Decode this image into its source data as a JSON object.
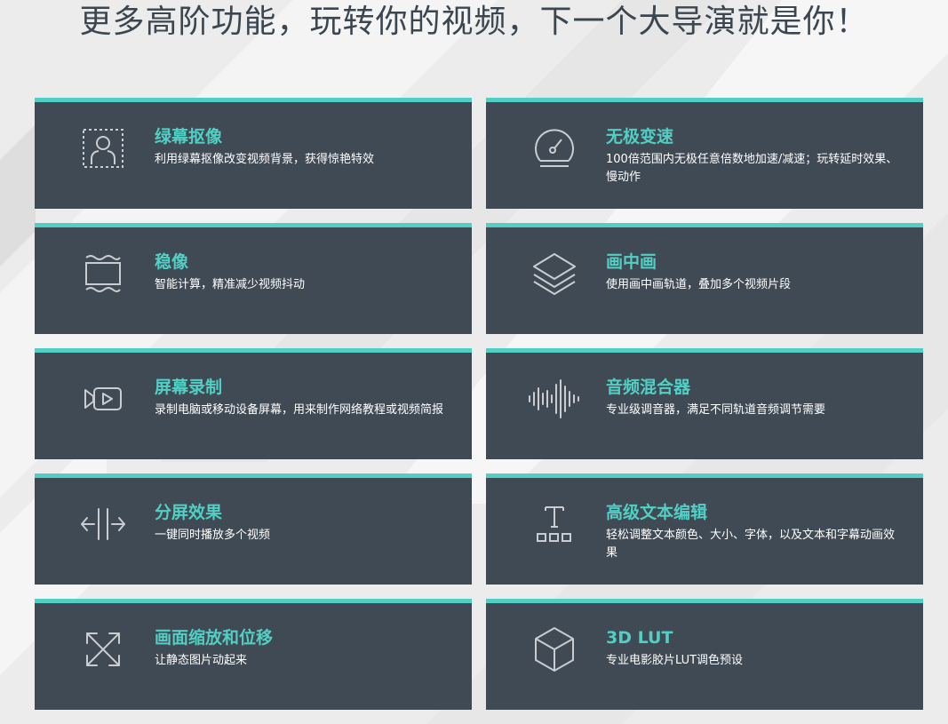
{
  "header": {
    "title": "更多高阶功能，玩转你的视频，下一个大导演就是你！"
  },
  "colors": {
    "accent": "#52cfc4",
    "card_background": "#3f4a54",
    "description_text": "#ffffff",
    "title_text": "#3c4650",
    "icon_stroke": "#c9cdd1"
  },
  "features": [
    {
      "icon": "green-screen-icon",
      "title": "绿幕抠像",
      "desc": "利用绿幕抠像改变视频背景，获得惊艳特效"
    },
    {
      "icon": "speedometer-icon",
      "title": "无极变速",
      "desc": "100倍范围内无极任意倍数地加速/减速；玩转延时效果、慢动作"
    },
    {
      "icon": "stabilization-icon",
      "title": "稳像",
      "desc": "智能计算，精准减少视频抖动"
    },
    {
      "icon": "layers-icon",
      "title": "画中画",
      "desc": "使用画中画轨道，叠加多个视频片段"
    },
    {
      "icon": "screen-record-icon",
      "title": "屏幕录制",
      "desc": "录制电脑或移动设备屏幕，用来制作网络教程或视频简报"
    },
    {
      "icon": "sound-wave-icon",
      "title": "音频混合器",
      "desc": "专业级调音器，满足不同轨道音频调节需要"
    },
    {
      "icon": "split-screen-icon",
      "title": "分屏效果",
      "desc": "一键同时播放多个视频"
    },
    {
      "icon": "text-edit-icon",
      "title": "高级文本编辑",
      "desc": "轻松调整文本颜色、大小、字体，以及文本和字幕动画效果"
    },
    {
      "icon": "pan-zoom-icon",
      "title": "画面缩放和位移",
      "desc": "让静态图片动起来"
    },
    {
      "icon": "cube-icon",
      "title": "3D LUT",
      "desc": "专业电影胶片LUT调色预设"
    }
  ]
}
